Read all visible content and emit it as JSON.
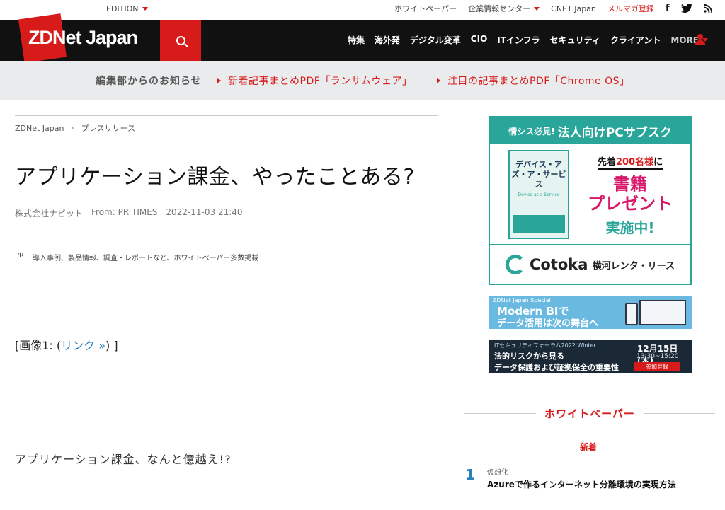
{
  "topbar": {
    "edition": "EDITION",
    "links": [
      "ホワイトペーパー",
      "企業情報センター",
      "CNET Japan",
      "メルマガ登録"
    ],
    "social": [
      "f",
      "facebook-icon",
      "twitter-icon",
      "rss-icon"
    ]
  },
  "header": {
    "logo": "ZDNet Japan",
    "nav": [
      "特集",
      "海外発",
      "デジタル変革",
      "CIO",
      "ITインフラ",
      "セキュリティ",
      "クライアント"
    ],
    "more": "MORE"
  },
  "notice": {
    "label": "編集部からのお知らせ",
    "link1": "新着記事まとめPDF「ランサムウェア」",
    "link2": "注目の記事まとめPDF「Chrome OS」"
  },
  "article": {
    "breadcrumb": [
      "ZDNet Japan",
      "プレスリリース"
    ],
    "title": "アプリケーション課金、やったことある?",
    "company": "株式会社ナビット",
    "from": "From: PR TIMES",
    "date": "2022-11-03 21:40",
    "pr_tag": "PR",
    "pr_text": "導入事例、製品情報、調査・レポートなど、ホワイトペーパー多数掲載",
    "image_ref_prefix": "[画像1: (",
    "image_ref_link": "リンク »",
    "image_ref_suffix": ") ]",
    "paragraph": "アプリケーション課金、なんと億越え!?"
  },
  "ad1": {
    "head_small": "情シス必見!",
    "head_big": "法人向けPCサブスク",
    "book_title": "デバイス・アズ・ア・サービス",
    "book_sub": "Device as a Service",
    "offer_top_pre": "先着",
    "offer_num": "200名様",
    "offer_top_post": "に",
    "offer_big1": "書籍",
    "offer_big2": "プレゼント",
    "offer_green": "実施中!",
    "brand": "Cotoka",
    "lessor": "横河レンタ・リース"
  },
  "ad2": {
    "small": "ZDNet Japan Special",
    "line1": "Modern BIで",
    "line2": "データ活用は次の舞台へ"
  },
  "ad3": {
    "small": "ITセキュリティフォーラム2022 Winter",
    "line1": "法的リスクから見る",
    "line2": "データ保護および証拠保全の重要性",
    "date": "12月15日(木)",
    "time": "13:30~15:20",
    "button": "参加登録"
  },
  "whitepaper": {
    "title": "ホワイトペーパー",
    "new_label": "新着",
    "items": [
      {
        "rank": "1",
        "category": "仮想化",
        "title": "Azureで作るインターネット分離環境の実現方法"
      }
    ]
  }
}
